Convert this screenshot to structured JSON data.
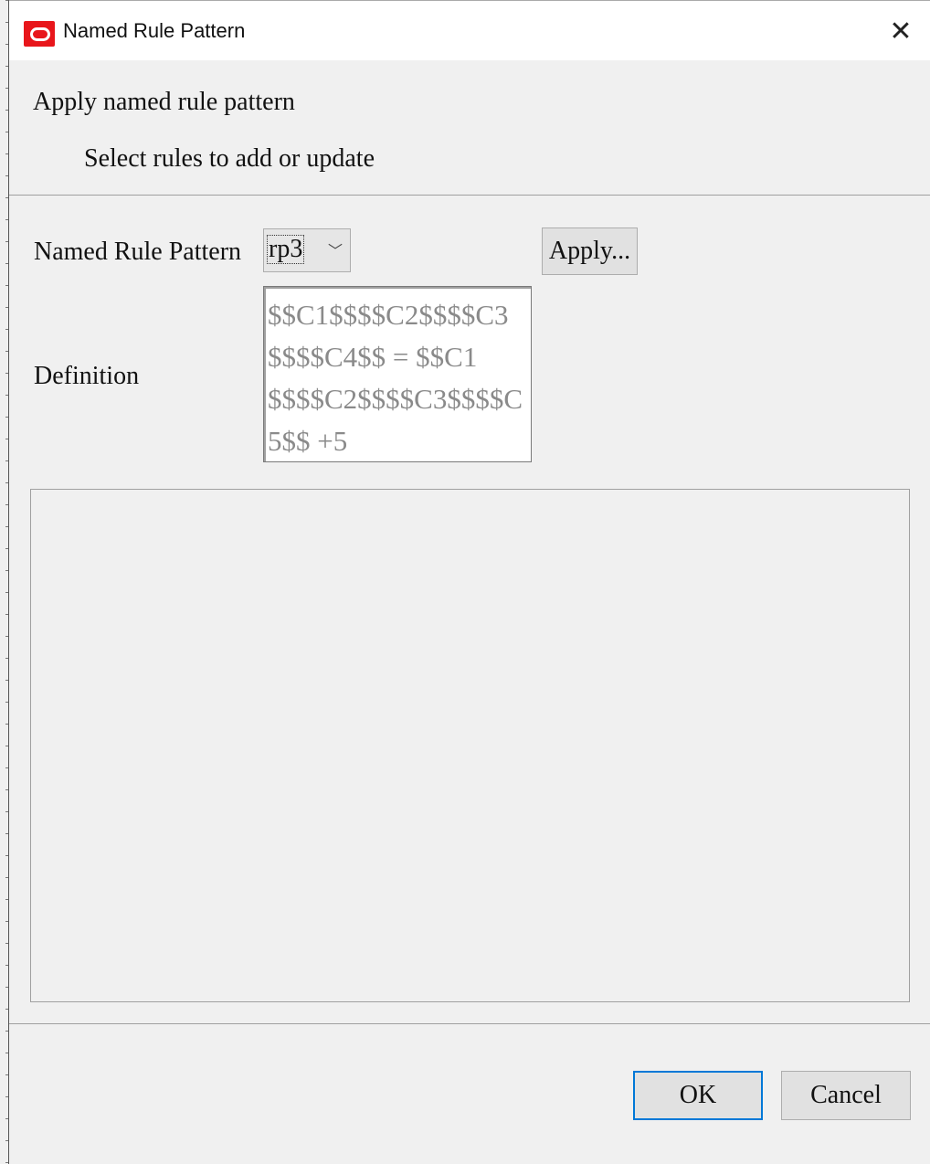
{
  "window": {
    "title": "Named Rule Pattern",
    "close_symbol": "✕",
    "icon": "oracle-logo-icon"
  },
  "header": {
    "title": "Apply named rule pattern",
    "subtitle": "Select rules to add or update"
  },
  "form": {
    "pattern_label": "Named Rule Pattern",
    "pattern_value": "rp3",
    "apply_label": "Apply...",
    "definition_label": "Definition",
    "definition_value": "$$C1$$$$C2$$$$C3$$$$C4$$ = $$C1$$$$C2$$$$C3$$$$C5$$ +5"
  },
  "footer": {
    "ok_label": "OK",
    "cancel_label": "Cancel"
  },
  "colors": {
    "accent": "#0078d7",
    "brand": "#e8161b",
    "definition_text": "#8a8a8a"
  }
}
